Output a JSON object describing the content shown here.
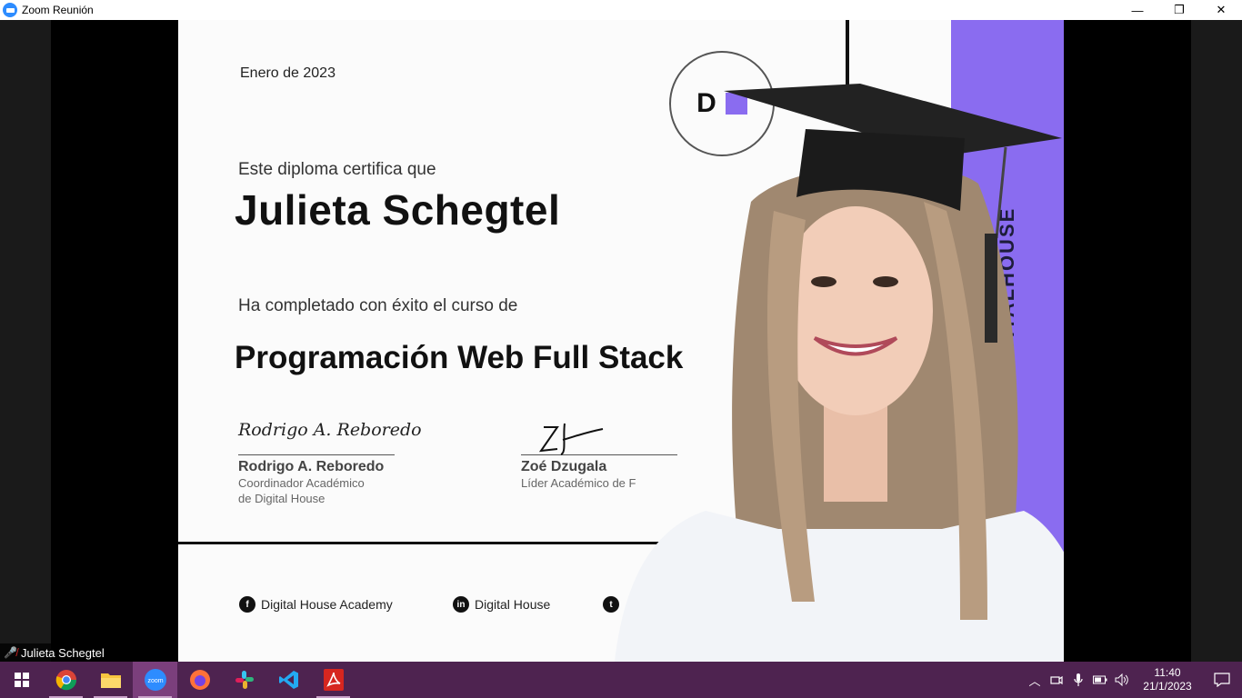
{
  "window": {
    "title": "Zoom Reunión",
    "minimize": "—",
    "restore": "❐",
    "close": "✕"
  },
  "certificate": {
    "date": "Enero de 2023",
    "intro": "Este diploma certifica que",
    "name": "Julieta Schegtel",
    "completed": "Ha completado con éxito el curso de",
    "course": "Programación Web Full Stack",
    "brand": "DIGITALHOUSE",
    "signatures": [
      {
        "script": "Rodrigo A. Reboredo",
        "name": "Rodrigo A. Reboredo",
        "role_line1": "Coordinador Académico",
        "role_line2": "de Digital House"
      },
      {
        "script": "ZoB",
        "name": "Zoé Dzugala",
        "role_line1": "Líder Académico de F",
        "role_line2": ""
      }
    ],
    "social": [
      {
        "icon": "facebook-icon",
        "glyph": "f",
        "label": "Digital House Academy"
      },
      {
        "icon": "linkedin-icon",
        "glyph": "in",
        "label": "Digital House"
      },
      {
        "icon": "twitter-icon",
        "glyph": "t",
        "label": ""
      }
    ],
    "accent_color": "#8a6cf0"
  },
  "participant": {
    "name": "Julieta Schegtel",
    "mic_icon": "mic-muted-icon"
  },
  "taskbar": {
    "apps": [
      {
        "name": "chrome",
        "icon": "chrome-icon"
      },
      {
        "name": "file-explorer",
        "icon": "folder-icon"
      },
      {
        "name": "zoom",
        "icon": "zoom-icon",
        "label": "zoom"
      },
      {
        "name": "firefox",
        "icon": "firefox-icon"
      },
      {
        "name": "slack",
        "icon": "slack-icon"
      },
      {
        "name": "vscode",
        "icon": "vscode-icon"
      },
      {
        "name": "acrobat",
        "icon": "acrobat-icon"
      }
    ],
    "time": "11:40",
    "date": "21/1/2023",
    "color": "#4e2350"
  }
}
